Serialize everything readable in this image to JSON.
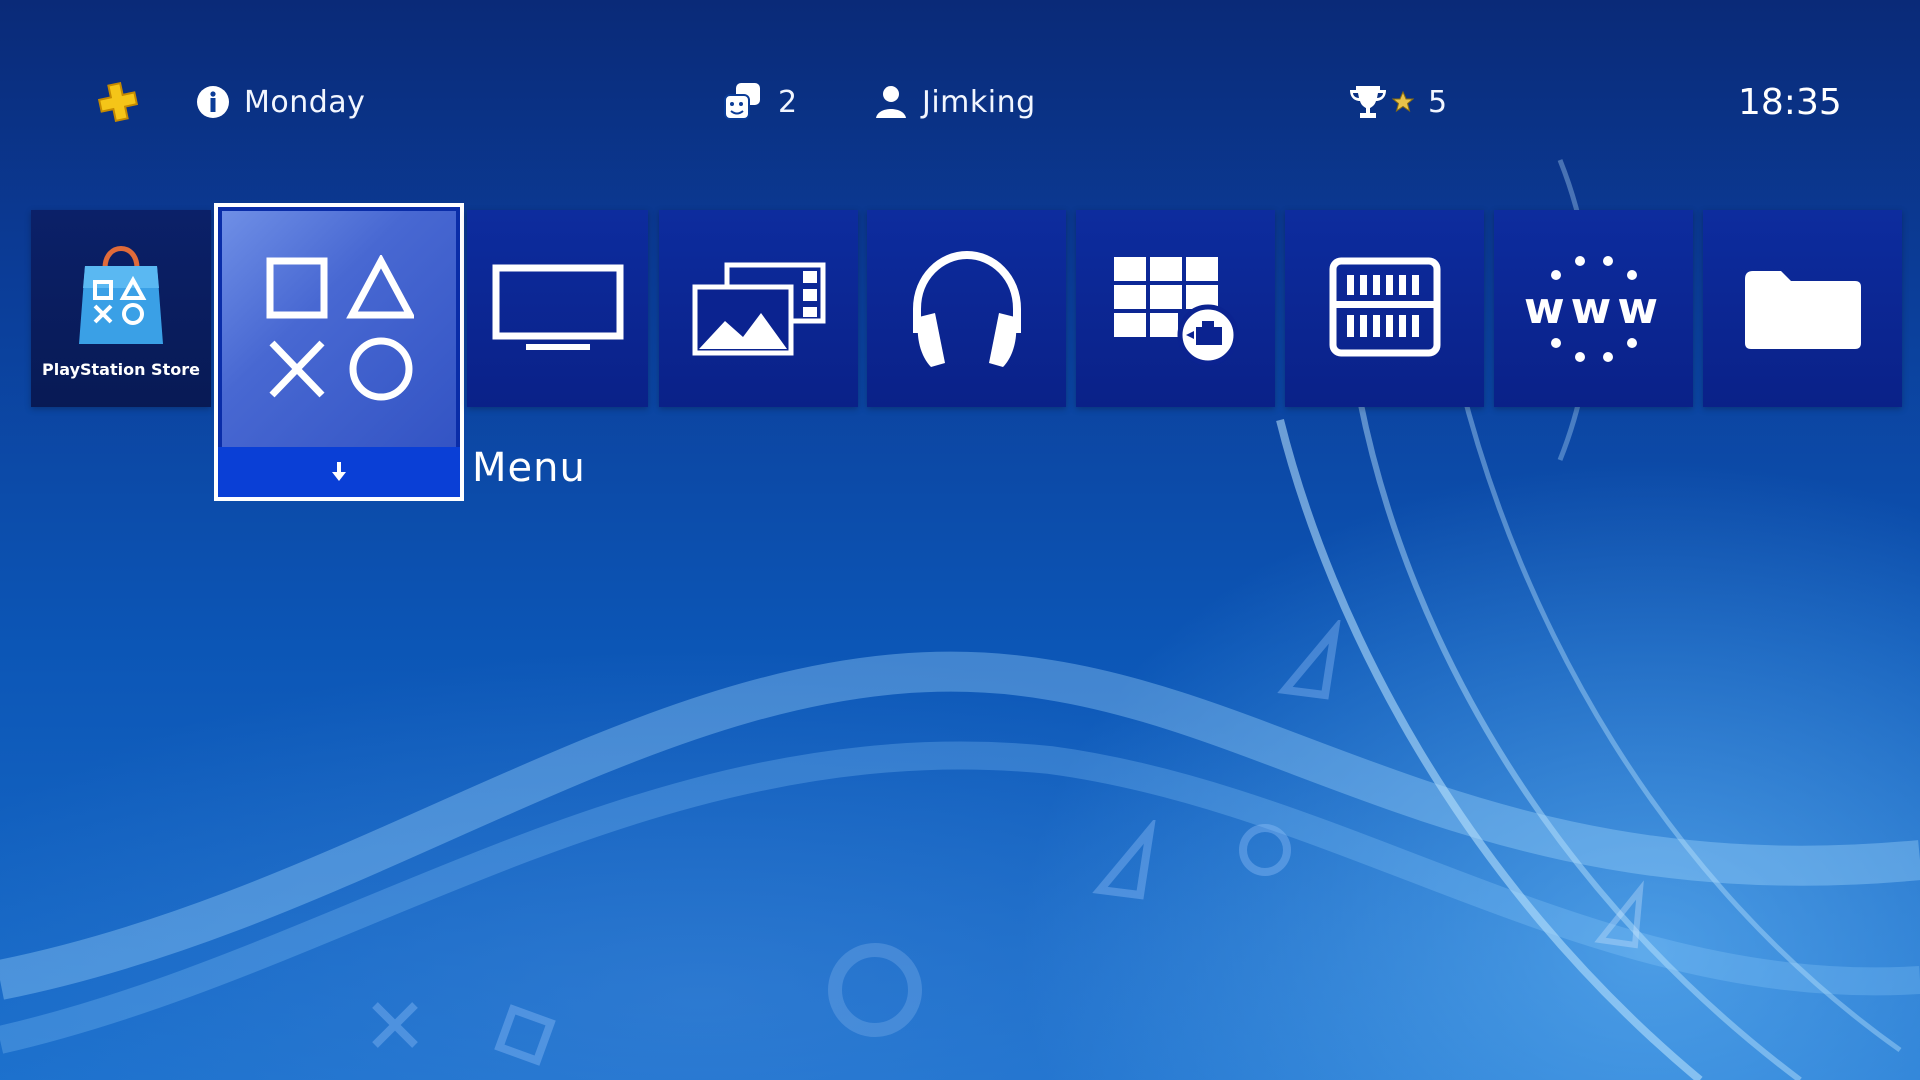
{
  "status_bar": {
    "plus_icon": "playstation-plus-icon",
    "info_icon": "info-icon",
    "info_text": "Monday",
    "friends_icon": "friends-icon",
    "friends_count": "2",
    "user_icon": "user-icon",
    "username": "Jimking",
    "trophy_icon": "trophy-icon",
    "trophy_star_icon": "star-icon",
    "trophy_count": "5",
    "clock": "18:35"
  },
  "tiles": [
    {
      "id": "store",
      "label": "PlayStation Store",
      "icon": "playstation-store-bag-icon"
    },
    {
      "id": "menu",
      "label": "Menu",
      "icon": "playstation-shapes-icon",
      "selected": true,
      "footer_icon": "arrow-down-icon"
    },
    {
      "id": "tv",
      "icon": "tv-video-icon"
    },
    {
      "id": "gallery",
      "icon": "capture-gallery-icon"
    },
    {
      "id": "music",
      "icon": "headphones-icon"
    },
    {
      "id": "apps",
      "icon": "live-from-playstation-icon"
    },
    {
      "id": "library",
      "icon": "library-icon"
    },
    {
      "id": "browser",
      "icon": "internet-browser-icon",
      "glyph": "www"
    },
    {
      "id": "folder",
      "icon": "folder-icon"
    }
  ],
  "colors": {
    "background_top": "#0a2a78",
    "background_bottom": "#1a6fcc",
    "tile": "#0d2c9e",
    "selected_face": "#4868d2",
    "selected_footer": "#0a3fd6",
    "plus_gold": "#f5c518"
  }
}
